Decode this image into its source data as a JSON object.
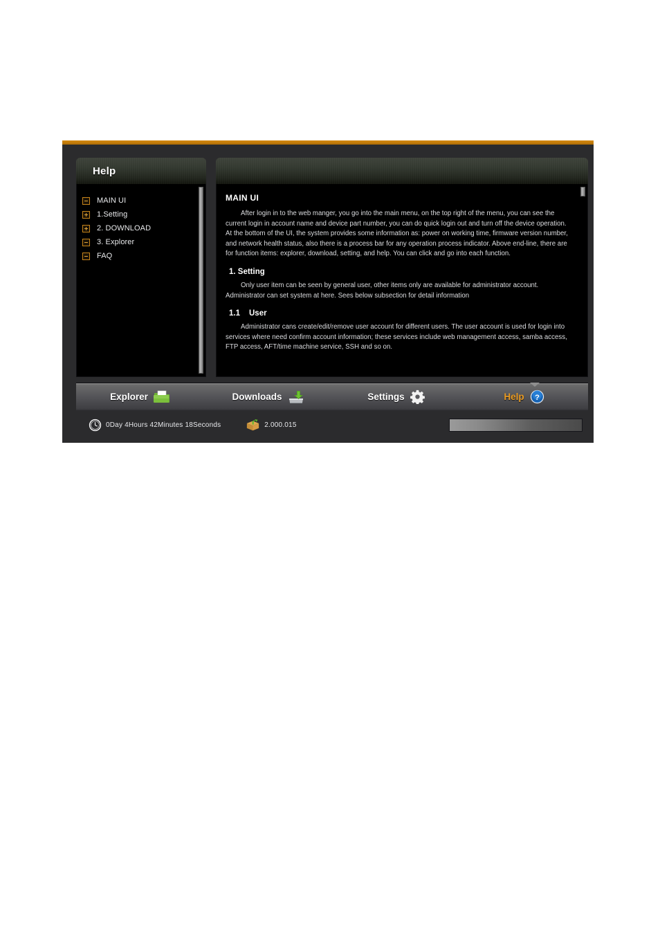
{
  "window": {
    "accent_color": "#c8851a",
    "background": "#2b2b2d"
  },
  "nav_panel": {
    "title": "Help",
    "tree_items": [
      {
        "label": "MAIN UI",
        "state": "expanded",
        "icon": "minus-box-icon"
      },
      {
        "label": "1.Setting",
        "state": "collapsed",
        "icon": "plus-box-icon"
      },
      {
        "label": "2. DOWNLOAD",
        "state": "collapsed",
        "icon": "plus-box-icon"
      },
      {
        "label": "3. Explorer",
        "state": "expanded",
        "icon": "minus-box-icon"
      },
      {
        "label": "FAQ",
        "state": "expanded",
        "icon": "minus-box-icon"
      }
    ]
  },
  "content_panel": {
    "title": "",
    "doc": {
      "h1": "MAIN UI",
      "p1": "After login in to the web manger, you go into the main menu, on the top right of the menu, you can see the current login in account name and device part number, you can do quick login out and turn off the device operation. At the bottom of the UI, the system provides some information as: power on working time, firmware version number, and network health status, also there is a process bar for any operation process indicator. Above end-line, there are for function items: explorer, download, setting, and help. You can click and go into each function.",
      "h2": "1. Setting",
      "p2": "Only user item can be seen by general user, other items only are available for administrator account. Administrator can set system at here. Sees below subsection for detail information",
      "h3_num": "1.1",
      "h3_text": "User",
      "p3": "Administrator cans create/edit/remove user account for different users. The user account is used for login into services where need confirm account information; these services include web management access, samba access, FTP access, AFT/time machine service, SSH and so on."
    }
  },
  "navbar": {
    "tabs": [
      {
        "label": "Explorer",
        "icon": "folder-icon",
        "active": false
      },
      {
        "label": "Downloads",
        "icon": "download-drive-icon",
        "active": false
      },
      {
        "label": "Settings",
        "icon": "gear-icon",
        "active": false
      },
      {
        "label": "Help",
        "icon": "help-circle-icon",
        "active": true
      }
    ],
    "active_color": "#e89a22"
  },
  "statusbar": {
    "uptime_icon": "clock-icon",
    "uptime": "0Day 4Hours 42Minutes 18Seconds",
    "version_icon": "package-box-icon",
    "version": "2.000.015",
    "progress_percent": 100
  }
}
